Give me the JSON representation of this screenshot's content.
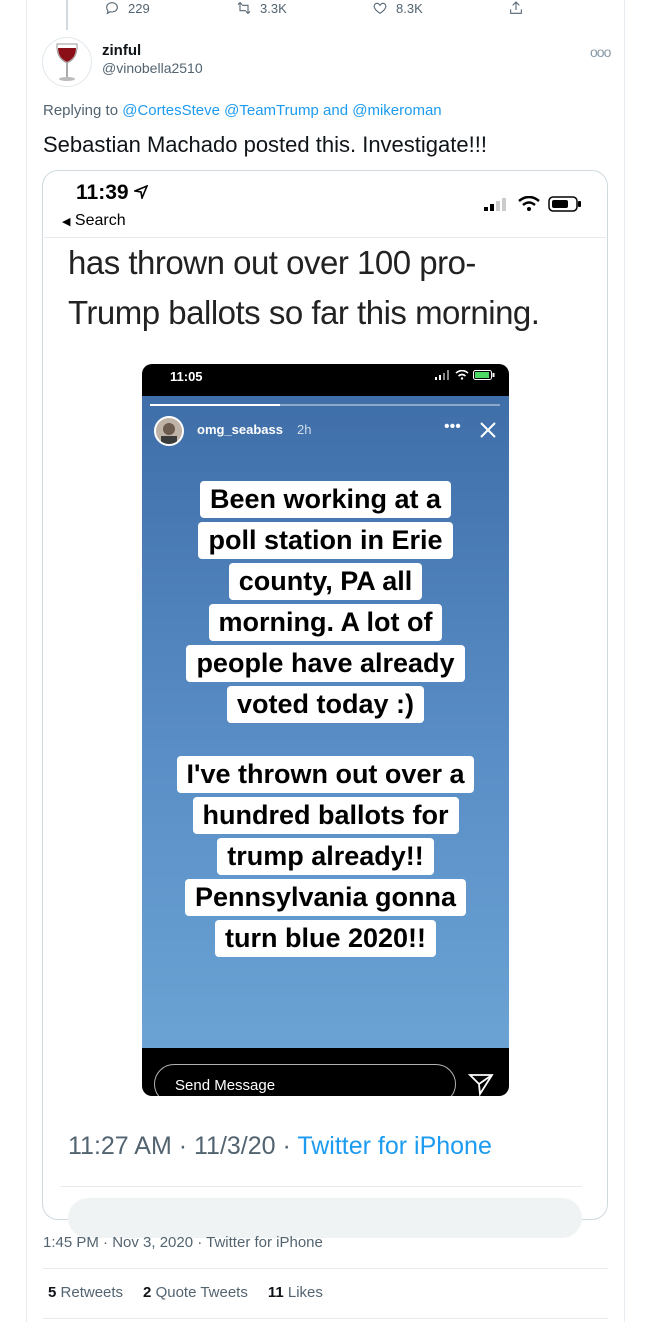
{
  "top_actions": {
    "reply_count": "229",
    "retweet_count": "3.3K",
    "like_count": "8.3K"
  },
  "tweet": {
    "display_name": "zinful",
    "handle": "@vinobella2510",
    "replying_prefix": "Replying to",
    "replying_to": "@CortesSteve @TeamTrump",
    "replying_and": "and",
    "replying_last": "@mikeroman",
    "text": "Sebastian Machado posted this. Investigate!!!",
    "meta": "1:45 PM · Nov 3, 2020 · Twitter for iPhone"
  },
  "screenshot": {
    "ios_time": "11:39",
    "back_label": "Search",
    "caption_line1": "has thrown out over 100 pro-",
    "caption_line2": "Trump ballots so far this morning.",
    "story": {
      "time": "11:05",
      "username": "omg_seabass",
      "age": "2h",
      "progress_fraction": 0.37,
      "block1": [
        "Been working at a",
        "poll station in Erie",
        "county, PA all",
        "morning. A lot of",
        "people have already",
        "voted today :)"
      ],
      "block2": [
        "I've thrown out over a",
        "hundred ballots for",
        "trump already!!",
        "Pennsylvania gonna",
        "turn blue 2020!!"
      ],
      "send_placeholder": "Send Message"
    },
    "inner_time": "11:27 AM · 11/3/20 ·",
    "inner_source": "Twitter for iPhone"
  },
  "stats": {
    "retweets_count": "5",
    "retweets_label": "Retweets",
    "quotes_count": "2",
    "quotes_label": "Quote Tweets",
    "likes_count": "11",
    "likes_label": "Likes"
  },
  "colors": {
    "link": "#1d9bf0",
    "muted": "#536471"
  }
}
